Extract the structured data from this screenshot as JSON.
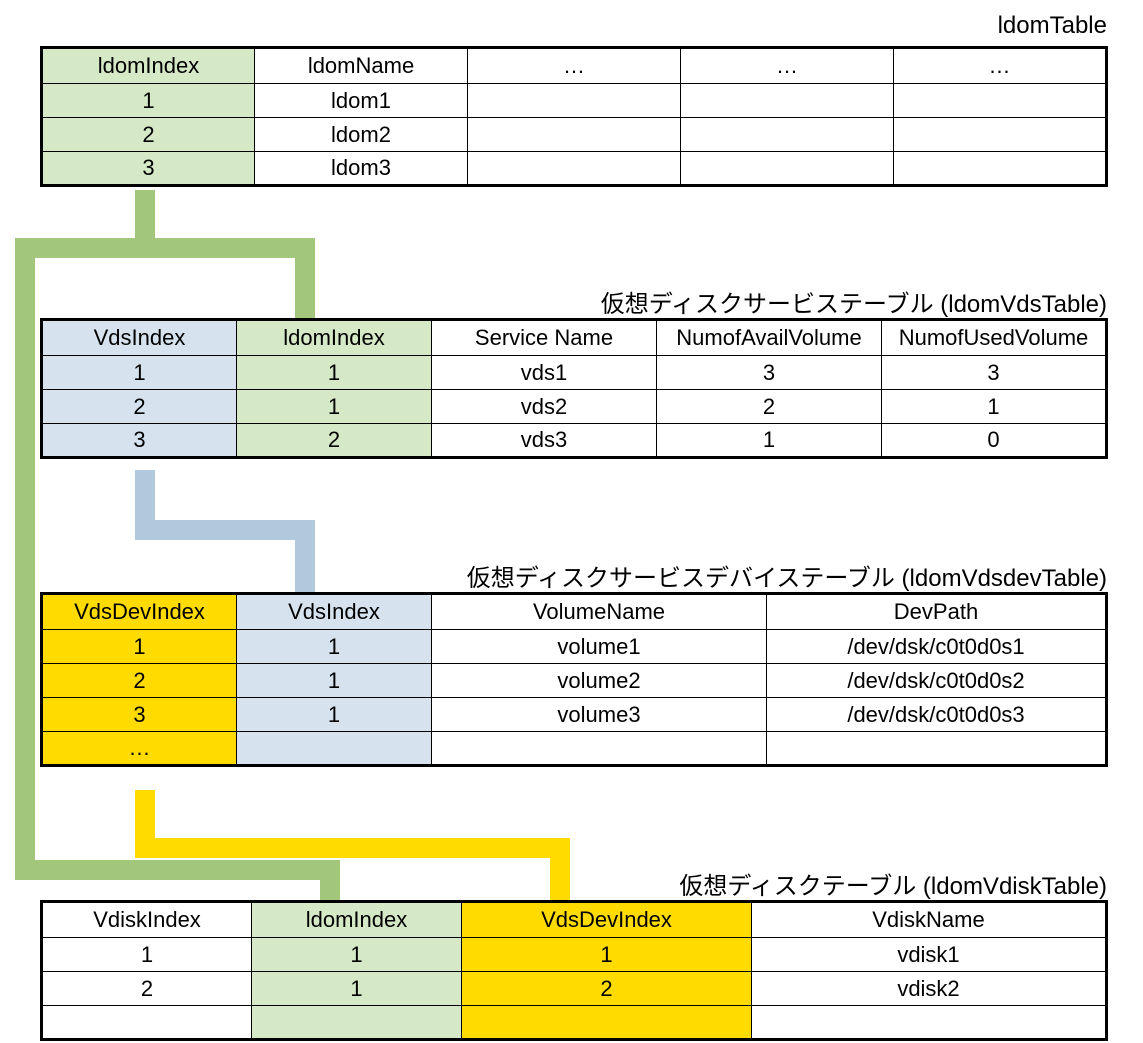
{
  "colors": {
    "green": "#d6e9c6",
    "blue": "#d6e3ef",
    "yellow": "#ffdb00",
    "greenStroke": "#a2c77a",
    "blueStroke": "#b0c9dd",
    "yellowStroke": "#ffdb00"
  },
  "titles": {
    "ldomTable": "ldomTable",
    "vdsTable": "仮想ディスクサービステーブル (ldomVdsTable)",
    "vdsdevTable": "仮想ディスクサービスデバイステーブル  (ldomVdsdevTable)",
    "vdiskTable": "仮想ディスクテーブル (ldomVdiskTable)"
  },
  "ldomTable": {
    "headers": [
      "ldomIndex",
      "ldomName",
      "…",
      "…",
      "…"
    ],
    "rows": [
      [
        "1",
        "ldom1",
        "",
        "",
        ""
      ],
      [
        "2",
        "ldom2",
        "",
        "",
        ""
      ],
      [
        "3",
        "ldom3",
        "",
        "",
        ""
      ]
    ]
  },
  "vdsTable": {
    "headers": [
      "VdsIndex",
      "ldomIndex",
      "Service Name",
      "NumofAvailVolume",
      "NumofUsedVolume"
    ],
    "rows": [
      [
        "1",
        "1",
        "vds1",
        "3",
        "3"
      ],
      [
        "2",
        "1",
        "vds2",
        "2",
        "1"
      ],
      [
        "3",
        "2",
        "vds3",
        "1",
        "0"
      ]
    ]
  },
  "vdsdevTable": {
    "headers": [
      "VdsDevIndex",
      "VdsIndex",
      "VolumeName",
      "DevPath"
    ],
    "rows": [
      [
        "1",
        "1",
        "volume1",
        "/dev/dsk/c0t0d0s1"
      ],
      [
        "2",
        "1",
        "volume2",
        "/dev/dsk/c0t0d0s2"
      ],
      [
        "3",
        "1",
        "volume3",
        "/dev/dsk/c0t0d0s3"
      ],
      [
        "…",
        "",
        "",
        ""
      ]
    ]
  },
  "vdiskTable": {
    "headers": [
      "VdiskIndex",
      "ldomIndex",
      "VdsDevIndex",
      "VdiskName"
    ],
    "rows": [
      [
        "1",
        "1",
        "1",
        "vdisk1"
      ],
      [
        "2",
        "1",
        "2",
        "vdisk2"
      ],
      [
        "",
        "",
        "",
        ""
      ]
    ]
  }
}
